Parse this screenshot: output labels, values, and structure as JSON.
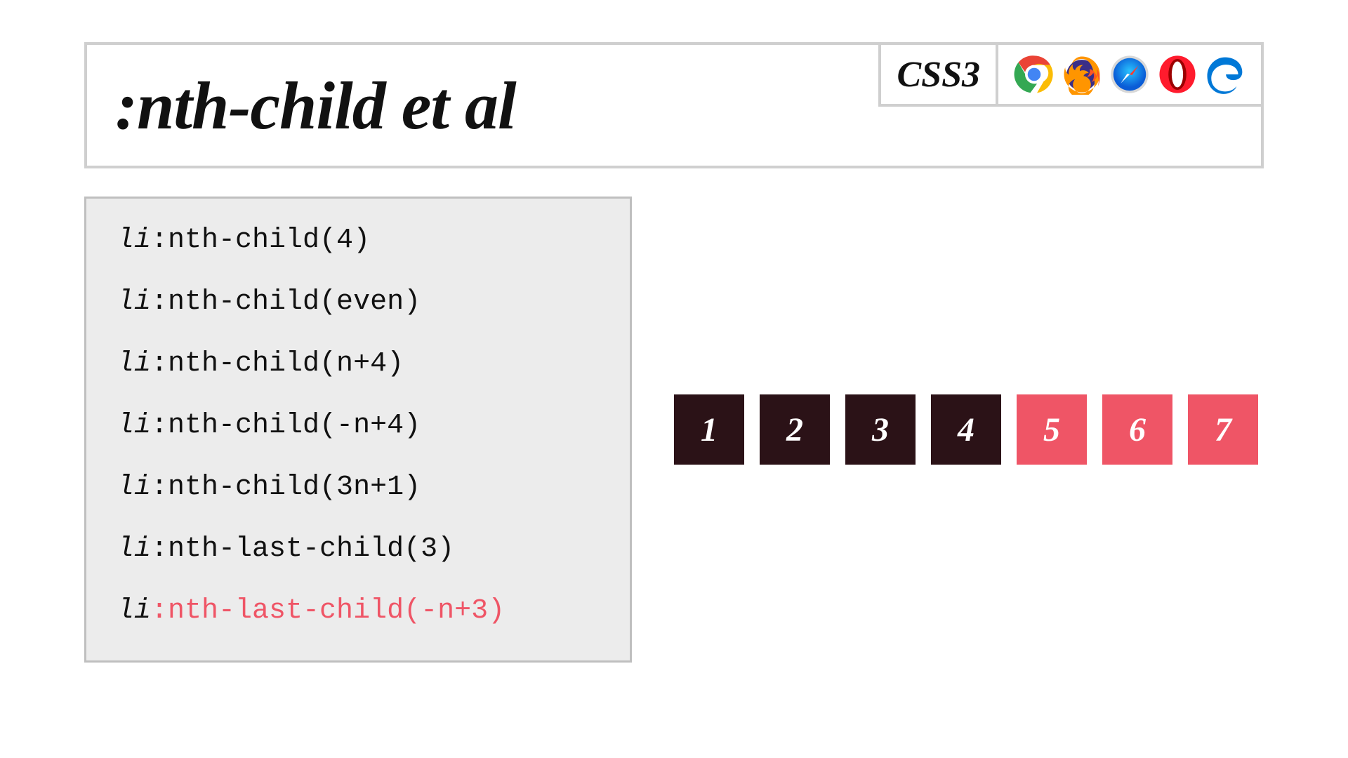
{
  "header": {
    "title": ":nth-child et al",
    "spec_badge": "CSS3",
    "browsers": [
      "chrome",
      "firefox",
      "safari",
      "opera",
      "edge"
    ]
  },
  "code": {
    "element": "li",
    "lines": [
      {
        "selector": ":nth-child(4)",
        "active": false
      },
      {
        "selector": ":nth-child(even)",
        "active": false
      },
      {
        "selector": ":nth-child(n+4)",
        "active": false
      },
      {
        "selector": ":nth-child(-n+4)",
        "active": false
      },
      {
        "selector": ":nth-child(3n+1)",
        "active": false
      },
      {
        "selector": ":nth-last-child(3)",
        "active": false
      },
      {
        "selector": ":nth-last-child(-n+3)",
        "active": true
      }
    ]
  },
  "demo": {
    "items": [
      {
        "label": "1",
        "highlighted": false
      },
      {
        "label": "2",
        "highlighted": false
      },
      {
        "label": "3",
        "highlighted": false
      },
      {
        "label": "4",
        "highlighted": false
      },
      {
        "label": "5",
        "highlighted": true
      },
      {
        "label": "6",
        "highlighted": true
      },
      {
        "label": "7",
        "highlighted": true
      }
    ]
  },
  "colors": {
    "dark_block": "#2b1217",
    "highlight": "#ef5566",
    "panel_bg": "#ececec",
    "panel_border": "#bfbfbf",
    "header_border": "#cfcfcf"
  }
}
